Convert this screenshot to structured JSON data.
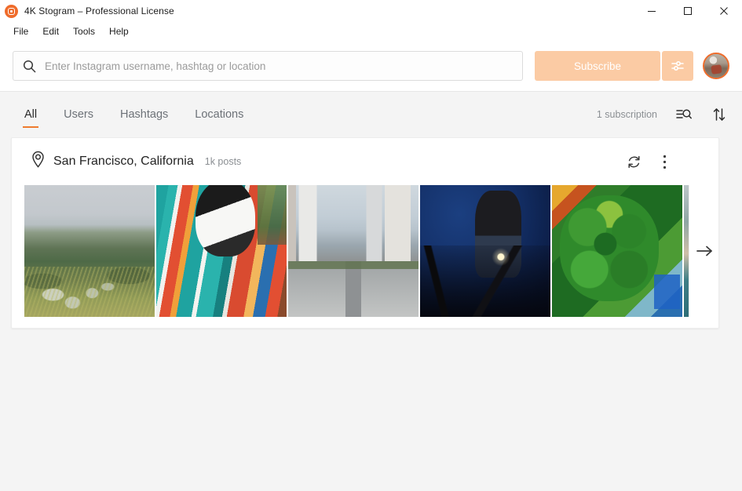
{
  "window": {
    "title": "4K Stogram – Professional License",
    "app_icon": "instagram-camera-icon",
    "controls": {
      "minimize": "minimize-icon",
      "maximize": "maximize-icon",
      "close": "close-icon"
    }
  },
  "menubar": {
    "items": [
      {
        "label": "File"
      },
      {
        "label": "Edit"
      },
      {
        "label": "Tools"
      },
      {
        "label": "Help"
      }
    ]
  },
  "search": {
    "icon": "search-icon",
    "placeholder": "Enter Instagram username, hashtag or location",
    "value": "",
    "subscribe_label": "Subscribe",
    "settings_icon": "sliders-icon",
    "avatar": "user-avatar"
  },
  "tabs": {
    "items": [
      {
        "label": "All",
        "active": true
      },
      {
        "label": "Users",
        "active": false
      },
      {
        "label": "Hashtags",
        "active": false
      },
      {
        "label": "Locations",
        "active": false
      }
    ],
    "subscription_count": "1 subscription",
    "filter_icon": "filter-search-icon",
    "sort_icon": "sort-arrows-icon"
  },
  "subscriptions": [
    {
      "icon": "location-pin-icon",
      "title": "San Francisco, California",
      "posts": "1k posts",
      "refresh_icon": "refresh-icon",
      "menu_icon": "more-vertical-icon",
      "next_icon": "arrow-right-icon",
      "thumbnails": [
        {
          "alt": "aerial view of hillside houses and trees"
        },
        {
          "alt": "boston terrier dog wrapped in striped serape blanket"
        },
        {
          "alt": "downtown san francisco street with cable car tracks and bay bridge"
        },
        {
          "alt": "cyclist at night wearing hoodie and face mask"
        },
        {
          "alt": "green succulent plant in a garden"
        },
        {
          "alt": "partially visible photo"
        }
      ]
    }
  ],
  "colors": {
    "accent": "#ef7b2e",
    "subscribe_disabled": "#fbcba4",
    "window_bg": "#f4f4f4",
    "card_bg": "#ffffff",
    "muted_text": "#8b8f93"
  }
}
